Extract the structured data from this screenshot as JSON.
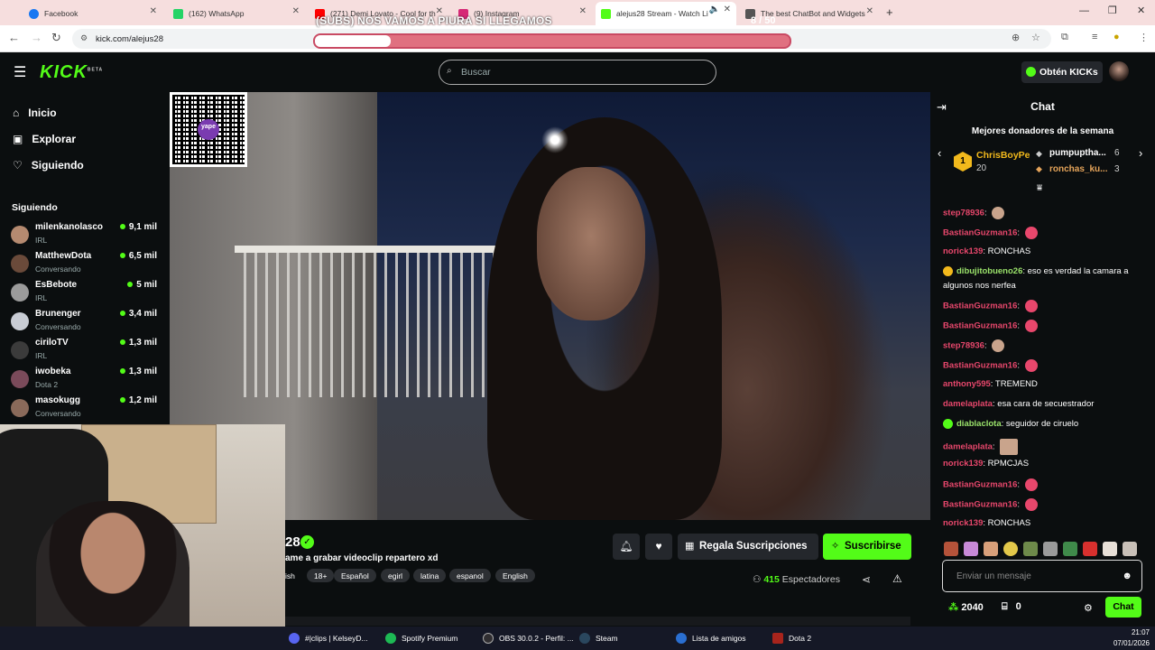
{
  "browser": {
    "tabs": [
      {
        "label": "Facebook",
        "color": "#1877f2"
      },
      {
        "label": "(162) WhatsApp",
        "color": "#25d366"
      },
      {
        "label": "(271) Demi Lovato - Cool for th",
        "color": "#ff0000"
      },
      {
        "label": "(9) Instagram",
        "color": "#d62976"
      },
      {
        "label": "alejus28 Stream - Watch Li",
        "color": "#53fc18"
      },
      {
        "label": "The best ChatBot and Widgets",
        "color": "#555555"
      }
    ],
    "url": "kick.com/alejus28"
  },
  "overlay": {
    "title": "(SUBS) NOS VAMOS A PIURA SI LLEGAMOS",
    "goal_count": "8   / 50",
    "goal_progress": 0.16
  },
  "kick": {
    "logo": "KICK",
    "logo_badge": "BETA",
    "search_placeholder": "Buscar",
    "kicks_button": "Obtén KICKs",
    "accent": "#53fc18"
  },
  "sidebar": {
    "nav": [
      {
        "label": "Inicio",
        "icon": "home-icon"
      },
      {
        "label": "Explorar",
        "icon": "compass-icon"
      },
      {
        "label": "Siguiendo",
        "icon": "heart-icon"
      }
    ],
    "following_heading": "Siguiendo",
    "following": [
      {
        "name": "milenkanolasco",
        "category": "IRL",
        "viewers": "9,1 mil"
      },
      {
        "name": "MatthewDota",
        "category": "Conversando",
        "viewers": "6,5 mil"
      },
      {
        "name": "EsBebote",
        "category": "IRL",
        "viewers": "5 mil"
      },
      {
        "name": "Brunenger",
        "category": "Conversando",
        "viewers": "3,4 mil"
      },
      {
        "name": "ciriloTV",
        "category": "IRL",
        "viewers": "1,3 mil"
      },
      {
        "name": "iwobeka",
        "category": "Dota 2",
        "viewers": "1,3 mil"
      },
      {
        "name": "masokugg",
        "category": "Conversando",
        "viewers": "1,2 mil"
      }
    ]
  },
  "qr": {
    "brand": "yape"
  },
  "channel": {
    "name_fragment": "28",
    "stream_title": "ame a grabar videoclip repartero xd",
    "tags": [
      "ish",
      "18+",
      "Español",
      "egirl",
      "latina",
      "espanol",
      "English"
    ],
    "gift_button": "Regala Suscripciones",
    "subscribe_button": "Suscribirse",
    "viewers": "415",
    "viewers_label": "Espectadores"
  },
  "chat": {
    "title": "Chat",
    "donors_heading": "Mejores donadores de la semana",
    "donors": [
      {
        "rank": "1",
        "name": "ChrisBoyPe",
        "amount": "20"
      },
      {
        "name": "pumpuptha...",
        "amount": "6"
      },
      {
        "name": "ronchas_ku...",
        "amount": "3"
      }
    ],
    "messages": [
      {
        "user": "step78936",
        "text": "",
        "color": "#e8476c",
        "emote": "face"
      },
      {
        "user": "BastianGuzman16",
        "text": "",
        "color": "#e8476c",
        "emote": "heart"
      },
      {
        "user": "norick139",
        "text": "RONCHAS",
        "color": "#e8476c"
      },
      {
        "user": "dibujitobueno26",
        "text": "eso es verdad la camara a",
        "text2": "algunos nos nerfea",
        "color": "#9be36b"
      },
      {
        "user": "BastianGuzman16",
        "text": "",
        "color": "#e8476c",
        "emote": "heart"
      },
      {
        "user": "BastianGuzman16",
        "text": "",
        "color": "#e8476c",
        "emote": "heart"
      },
      {
        "user": "step78936",
        "text": "",
        "color": "#e8476c",
        "emote": "face"
      },
      {
        "user": "BastianGuzman16",
        "text": "",
        "color": "#e8476c",
        "emote": "heart"
      },
      {
        "user": "anthony595",
        "text": "TREMEND",
        "color": "#e8476c"
      },
      {
        "user": "damelaplata",
        "text": "esa cara de secuestrador",
        "color": "#e8476c"
      },
      {
        "user": "diablaclota",
        "text": "seguidor de ciruelo",
        "color": "#9be36b"
      },
      {
        "user": "damelaplata",
        "text": "",
        "color": "#e8476c",
        "emote": "face"
      },
      {
        "user": "norick139",
        "text": "RPMCJAS",
        "color": "#e8476c"
      },
      {
        "user": "BastianGuzman16",
        "text": "",
        "color": "#e8476c",
        "emote": "heart"
      },
      {
        "user": "BastianGuzman16",
        "text": "",
        "color": "#e8476c",
        "emote": "heart"
      },
      {
        "user": "norick139",
        "text": "RONCHAS",
        "color": "#e8476c"
      }
    ],
    "input_placeholder": "Enviar un mensaje",
    "points": "2040",
    "drops": "0",
    "send_button": "Chat"
  },
  "taskbar": {
    "items": [
      {
        "label": "#|clips | KelseyD...",
        "color": "#5865f2"
      },
      {
        "label": "Spotify Premium",
        "color": "#1db954"
      },
      {
        "label": "OBS 30.0.2 - Perfil: ...",
        "color": "#302e31"
      },
      {
        "label": "Steam",
        "color": "#1b2838"
      },
      {
        "label": "Lista de amigos",
        "color": "#2a6fd1"
      },
      {
        "label": "Dota 2",
        "color": "#a8241c"
      }
    ],
    "time": "21:07",
    "date": "07/01/2026"
  }
}
